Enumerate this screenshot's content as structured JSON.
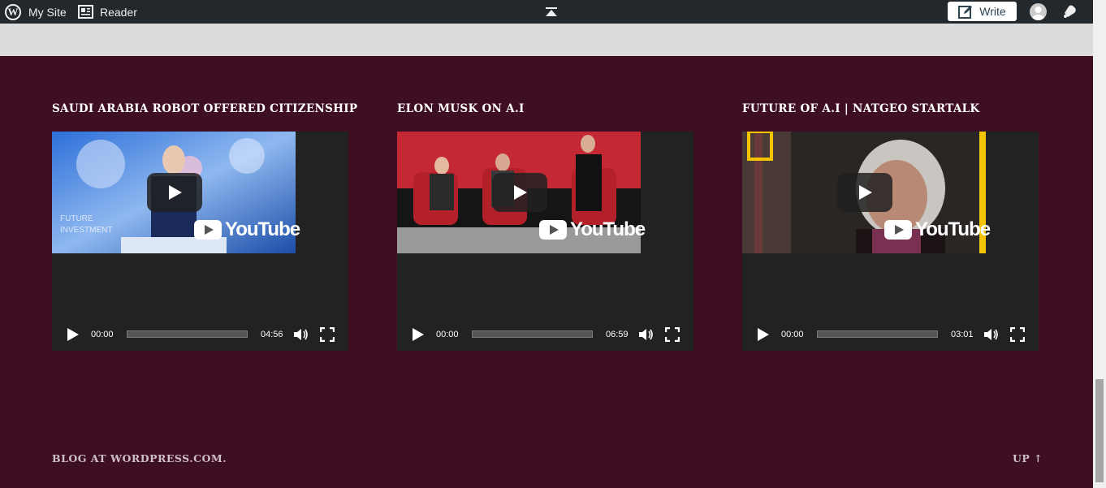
{
  "adminbar": {
    "mysite_label": "My Site",
    "reader_label": "Reader",
    "write_label": "Write",
    "logo_letter": "W",
    "icons": [
      "wordpress-logo-icon",
      "reader-icon",
      "collapse-top-icon",
      "write-pencil-icon",
      "avatar-icon",
      "notifications-bell-icon"
    ]
  },
  "widgets": [
    {
      "title": "SAUDI ARABIA ROBOT OFFERED CITIZENSHIP",
      "current_time": "00:00",
      "duration": "04:56",
      "thumbnail": "robot-sophia-blue-stage"
    },
    {
      "title": "ELON MUSK ON A.I",
      "current_time": "00:00",
      "duration": "06:59",
      "thumbnail": "three-people-red-chairs"
    },
    {
      "title": "FUTURE OF A.I | NATGEO STARTALK",
      "current_time": "00:00",
      "duration": "03:01",
      "thumbnail": "woman-interview-natgeo"
    }
  ],
  "youtube_label": "YouTube",
  "footer": {
    "credit": "BLOG AT WORDPRESS.COM.",
    "up_link": "UP ↑"
  },
  "colors": {
    "page_bg": "#3e0e22",
    "adminbar_bg": "#23282d",
    "player_bg": "#222222",
    "band": "#dcdcdc"
  }
}
